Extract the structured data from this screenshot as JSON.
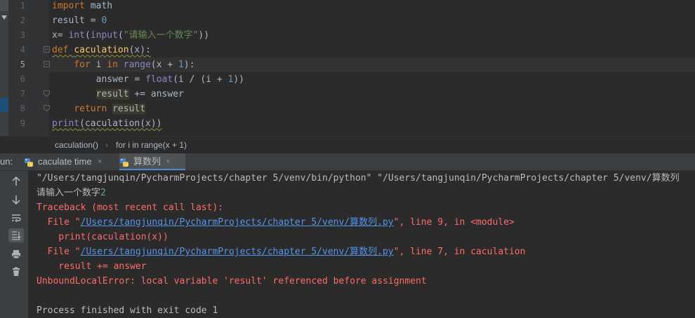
{
  "editor": {
    "lines": [
      {
        "number": "1",
        "tokens": [
          {
            "t": "import",
            "c": "kw"
          },
          {
            "t": " math",
            "c": ""
          }
        ]
      },
      {
        "number": "2",
        "tokens": [
          {
            "t": "result = ",
            "c": ""
          },
          {
            "t": "0",
            "c": "num"
          }
        ]
      },
      {
        "number": "3",
        "tokens": [
          {
            "t": "x",
            "c": ""
          },
          {
            "t": "= ",
            "c": ""
          },
          {
            "t": "int",
            "c": "bi"
          },
          {
            "t": "(",
            "c": ""
          },
          {
            "t": "input",
            "c": "bi"
          },
          {
            "t": "(",
            "c": ""
          },
          {
            "t": "\"请输入一个数字\"",
            "c": "str"
          },
          {
            "t": "))",
            "c": ""
          }
        ]
      },
      {
        "number": "4",
        "tokens": [
          {
            "t": "def ",
            "c": "kw wavy"
          },
          {
            "t": "caculation",
            "c": "fn wavy"
          },
          {
            "t": "(x):",
            "c": "wavy"
          }
        ]
      },
      {
        "number": "5",
        "tokens": [
          {
            "t": "    ",
            "c": ""
          },
          {
            "t": "for ",
            "c": "kw"
          },
          {
            "t": "i ",
            "c": ""
          },
          {
            "t": "in ",
            "c": "kw"
          },
          {
            "t": "range",
            "c": "bi"
          },
          {
            "t": "(x + ",
            "c": ""
          },
          {
            "t": "1",
            "c": "num"
          },
          {
            "t": "):",
            "c": ""
          }
        ]
      },
      {
        "number": "6",
        "tokens": [
          {
            "t": "        answer = ",
            "c": ""
          },
          {
            "t": "float",
            "c": "bi"
          },
          {
            "t": "(i / (i + ",
            "c": ""
          },
          {
            "t": "1",
            "c": "num"
          },
          {
            "t": "))",
            "c": ""
          }
        ]
      },
      {
        "number": "7",
        "tokens": [
          {
            "t": "        ",
            "c": ""
          },
          {
            "t": "result",
            "c": "hl"
          },
          {
            "t": " += answer",
            "c": ""
          }
        ]
      },
      {
        "number": "8",
        "tokens": [
          {
            "t": "    ",
            "c": ""
          },
          {
            "t": "return ",
            "c": "kw"
          },
          {
            "t": "result",
            "c": "hl"
          }
        ]
      },
      {
        "number": "9",
        "tokens": [
          {
            "t": "print",
            "c": "bi wavy"
          },
          {
            "t": "(caculation(x))",
            "c": "wavy"
          }
        ]
      }
    ],
    "current_line": "5"
  },
  "breadcrumb": {
    "fn": "caculation()",
    "separator": "›",
    "loop": "for i in range(x + 1)"
  },
  "run": {
    "label": "un:",
    "tabs": [
      {
        "label": "caculate time",
        "close": "×",
        "active": false
      },
      {
        "label": "算数列",
        "close": "×",
        "active": true
      }
    ]
  },
  "console": {
    "command": "\"/Users/tangjunqin/PycharmProjects/chapter 5/venv/bin/python\" \"/Users/tangjunqin/PycharmProjects/chapter 5/venv/算数列",
    "prompt": "请输入一个数字",
    "user_input": "2",
    "traceback_header": "Traceback (most recent call last):",
    "frame1_prefix": "  File \"",
    "frame1_path": "/Users/tangjunqin/PycharmProjects/chapter 5/venv/算数列.py",
    "frame1_suffix": "\", line 9, in <module>",
    "frame1_code": "    print(caculation(x))",
    "frame2_prefix": "  File \"",
    "frame2_path": "/Users/tangjunqin/PycharmProjects/chapter 5/venv/算数列.py",
    "frame2_suffix": "\", line 7, in caculation",
    "frame2_code": "    result += answer",
    "error": "UnboundLocalError: local variable 'result' referenced before assignment",
    "exit": "Process finished with exit code 1"
  },
  "toolbar_icons": [
    "arrow-up-icon",
    "arrow-down-icon",
    "soft-wrap-icon",
    "scroll-to-end-icon",
    "print-icon",
    "trash-icon"
  ],
  "colors": {
    "background": "#2b2b2b",
    "keyword": "#cc7832",
    "string": "#6a8759",
    "number": "#6897bb",
    "error": "#ff6b68",
    "link": "#5394ec",
    "input": "#6aab73"
  }
}
